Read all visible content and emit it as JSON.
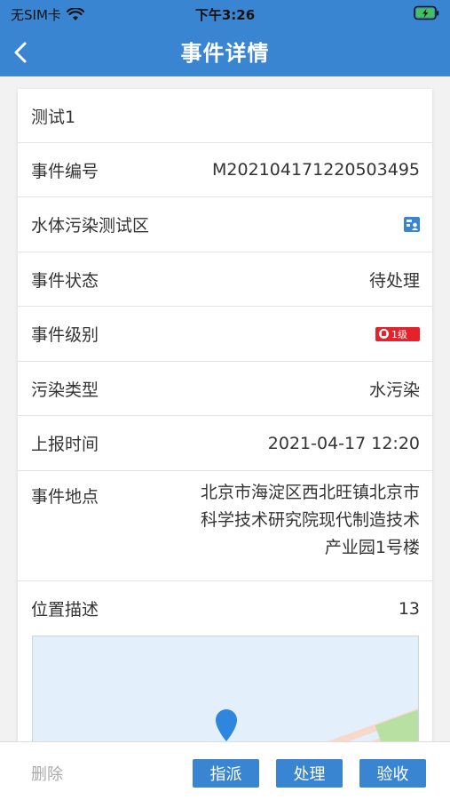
{
  "status_bar": {
    "carrier": "无SIM卡",
    "time": "下午3:26"
  },
  "header": {
    "title": "事件详情",
    "back_icon": "chevron-left-icon"
  },
  "colors": {
    "primary": "#3a85d2",
    "danger": "#e5212b",
    "disabled_text": "#aaaaaa"
  },
  "details": {
    "event_name": "测试1",
    "event_number_label": "事件编号",
    "event_number": "M202104171220503495",
    "zone_name": "水体污染测试区",
    "zone_icon": "zone-map-icon",
    "status_label": "事件状态",
    "status": "待处理",
    "level_label": "事件级别",
    "level": "1级",
    "pollution_type_label": "污染类型",
    "pollution_type": "水污染",
    "report_time_label": "上报时间",
    "report_time": "2021-04-17 12:20",
    "location_label": "事件地点",
    "location": "北京市海淀区西北旺镇北京市科学技术研究院现代制造技术产业园1号楼",
    "position_desc_label": "位置描述",
    "position_desc": "13"
  },
  "actions": {
    "delete": "删除",
    "dispatch": "指派",
    "process": "处理",
    "accept": "验收"
  }
}
